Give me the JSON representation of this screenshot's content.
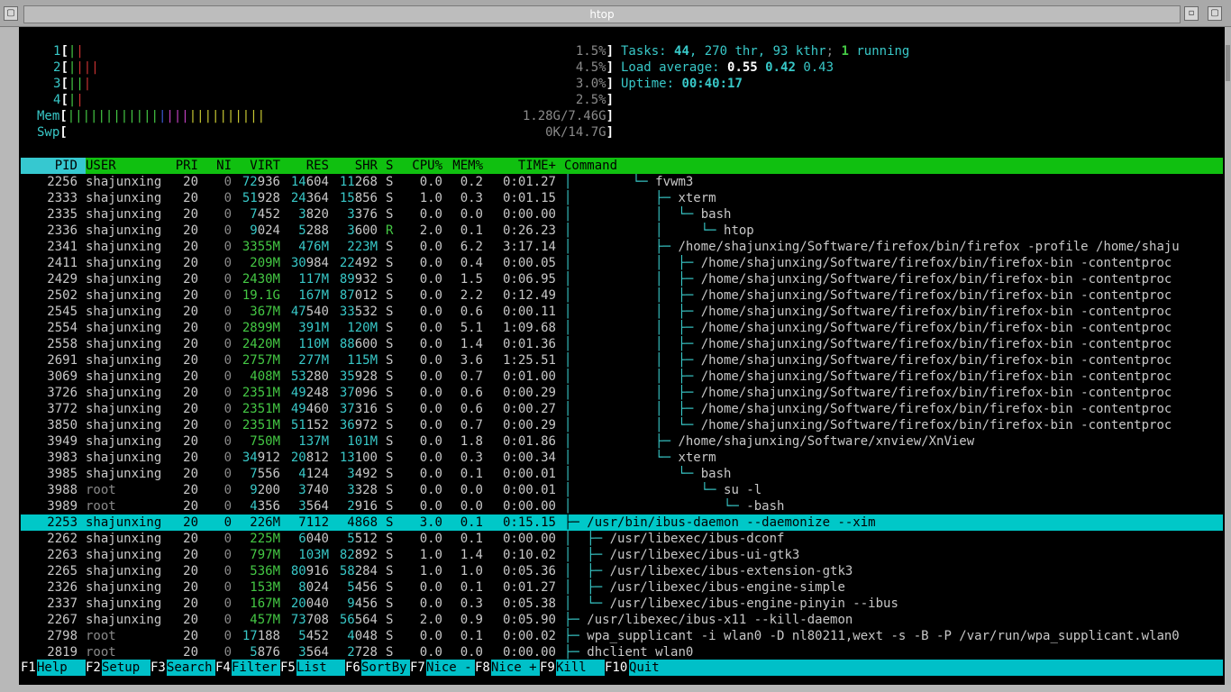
{
  "window": {
    "title": "htop"
  },
  "meters": {
    "cpus": [
      {
        "num": "1",
        "pct": "1.5%"
      },
      {
        "num": "2",
        "pct": "4.5%"
      },
      {
        "num": "3",
        "pct": "3.0%"
      },
      {
        "num": "4",
        "pct": "2.5%"
      }
    ],
    "mem": {
      "label": "Mem",
      "value": "1.28G/7.46G"
    },
    "swp": {
      "label": "Swp",
      "value": "0K/14.7G"
    }
  },
  "summary": {
    "tasks_label": "Tasks:",
    "tasks": "44",
    "thr": "270 thr",
    "kthr": "93 kthr",
    "running": "1",
    "running_label": "running",
    "load_label": "Load average:",
    "load1": "0.55",
    "load5": "0.42",
    "load15": "0.43",
    "uptime_label": "Uptime:",
    "uptime": "00:40:17"
  },
  "columns": [
    "PID",
    "USER",
    "PRI",
    "NI",
    "VIRT",
    "RES",
    "SHR",
    "S",
    "CPU%",
    "MEM%",
    "TIME+",
    "Command"
  ],
  "processes": [
    {
      "pid": "2256",
      "user": "shajunxing",
      "pri": "20",
      "ni": "0",
      "virt": "72936",
      "res": "14604",
      "shr": "11268",
      "s": "S",
      "cpu": "0.0",
      "mem": "0.2",
      "time": "0:01.27",
      "tree": "│        └─ ",
      "cmd": "fvwm3"
    },
    {
      "pid": "2333",
      "user": "shajunxing",
      "pri": "20",
      "ni": "0",
      "virt": "51928",
      "res": "24364",
      "shr": "15856",
      "s": "S",
      "cpu": "1.0",
      "mem": "0.3",
      "time": "0:01.15",
      "tree": "│           ├─ ",
      "cmd": "xterm"
    },
    {
      "pid": "2335",
      "user": "shajunxing",
      "pri": "20",
      "ni": "0",
      "virt": "7452",
      "res": "3820",
      "shr": "3376",
      "s": "S",
      "cpu": "0.0",
      "mem": "0.0",
      "time": "0:00.00",
      "tree": "│           │  └─ ",
      "cmd": "bash"
    },
    {
      "pid": "2336",
      "user": "shajunxing",
      "pri": "20",
      "ni": "0",
      "virt": "9024",
      "res": "5288",
      "shr": "3600",
      "s": "R",
      "cpu": "2.0",
      "mem": "0.1",
      "time": "0:26.23",
      "tree": "│           │     └─ ",
      "cmd": "htop"
    },
    {
      "pid": "2341",
      "user": "shajunxing",
      "pri": "20",
      "ni": "0",
      "virt": "3355M",
      "res": "476M",
      "shr": "223M",
      "s": "S",
      "cpu": "0.0",
      "mem": "6.2",
      "time": "3:17.14",
      "tree": "│           ├─ ",
      "cmd": "/home/shajunxing/Software/firefox/bin/firefox -profile /home/shaju"
    },
    {
      "pid": "2411",
      "user": "shajunxing",
      "pri": "20",
      "ni": "0",
      "virt": "209M",
      "res": "30984",
      "shr": "22492",
      "s": "S",
      "cpu": "0.0",
      "mem": "0.4",
      "time": "0:00.05",
      "tree": "│           │  ├─ ",
      "cmd": "/home/shajunxing/Software/firefox/bin/firefox-bin -contentproc"
    },
    {
      "pid": "2429",
      "user": "shajunxing",
      "pri": "20",
      "ni": "0",
      "virt": "2430M",
      "res": "117M",
      "shr": "89932",
      "s": "S",
      "cpu": "0.0",
      "mem": "1.5",
      "time": "0:06.95",
      "tree": "│           │  ├─ ",
      "cmd": "/home/shajunxing/Software/firefox/bin/firefox-bin -contentproc"
    },
    {
      "pid": "2502",
      "user": "shajunxing",
      "pri": "20",
      "ni": "0",
      "virt": "19.1G",
      "res": "167M",
      "shr": "87012",
      "s": "S",
      "cpu": "0.0",
      "mem": "2.2",
      "time": "0:12.49",
      "tree": "│           │  ├─ ",
      "cmd": "/home/shajunxing/Software/firefox/bin/firefox-bin -contentproc"
    },
    {
      "pid": "2545",
      "user": "shajunxing",
      "pri": "20",
      "ni": "0",
      "virt": "367M",
      "res": "47540",
      "shr": "33532",
      "s": "S",
      "cpu": "0.0",
      "mem": "0.6",
      "time": "0:00.11",
      "tree": "│           │  ├─ ",
      "cmd": "/home/shajunxing/Software/firefox/bin/firefox-bin -contentproc"
    },
    {
      "pid": "2554",
      "user": "shajunxing",
      "pri": "20",
      "ni": "0",
      "virt": "2899M",
      "res": "391M",
      "shr": "120M",
      "s": "S",
      "cpu": "0.0",
      "mem": "5.1",
      "time": "1:09.68",
      "tree": "│           │  ├─ ",
      "cmd": "/home/shajunxing/Software/firefox/bin/firefox-bin -contentproc"
    },
    {
      "pid": "2558",
      "user": "shajunxing",
      "pri": "20",
      "ni": "0",
      "virt": "2420M",
      "res": "110M",
      "shr": "88600",
      "s": "S",
      "cpu": "0.0",
      "mem": "1.4",
      "time": "0:01.36",
      "tree": "│           │  ├─ ",
      "cmd": "/home/shajunxing/Software/firefox/bin/firefox-bin -contentproc"
    },
    {
      "pid": "2691",
      "user": "shajunxing",
      "pri": "20",
      "ni": "0",
      "virt": "2757M",
      "res": "277M",
      "shr": "115M",
      "s": "S",
      "cpu": "0.0",
      "mem": "3.6",
      "time": "1:25.51",
      "tree": "│           │  ├─ ",
      "cmd": "/home/shajunxing/Software/firefox/bin/firefox-bin -contentproc"
    },
    {
      "pid": "3069",
      "user": "shajunxing",
      "pri": "20",
      "ni": "0",
      "virt": "408M",
      "res": "53280",
      "shr": "35928",
      "s": "S",
      "cpu": "0.0",
      "mem": "0.7",
      "time": "0:01.00",
      "tree": "│           │  ├─ ",
      "cmd": "/home/shajunxing/Software/firefox/bin/firefox-bin -contentproc"
    },
    {
      "pid": "3726",
      "user": "shajunxing",
      "pri": "20",
      "ni": "0",
      "virt": "2351M",
      "res": "49248",
      "shr": "37096",
      "s": "S",
      "cpu": "0.0",
      "mem": "0.6",
      "time": "0:00.29",
      "tree": "│           │  ├─ ",
      "cmd": "/home/shajunxing/Software/firefox/bin/firefox-bin -contentproc"
    },
    {
      "pid": "3772",
      "user": "shajunxing",
      "pri": "20",
      "ni": "0",
      "virt": "2351M",
      "res": "49460",
      "shr": "37316",
      "s": "S",
      "cpu": "0.0",
      "mem": "0.6",
      "time": "0:00.27",
      "tree": "│           │  ├─ ",
      "cmd": "/home/shajunxing/Software/firefox/bin/firefox-bin -contentproc"
    },
    {
      "pid": "3850",
      "user": "shajunxing",
      "pri": "20",
      "ni": "0",
      "virt": "2351M",
      "res": "51152",
      "shr": "36972",
      "s": "S",
      "cpu": "0.0",
      "mem": "0.7",
      "time": "0:00.29",
      "tree": "│           │  └─ ",
      "cmd": "/home/shajunxing/Software/firefox/bin/firefox-bin -contentproc"
    },
    {
      "pid": "3949",
      "user": "shajunxing",
      "pri": "20",
      "ni": "0",
      "virt": "750M",
      "res": "137M",
      "shr": "101M",
      "s": "S",
      "cpu": "0.0",
      "mem": "1.8",
      "time": "0:01.86",
      "tree": "│           ├─ ",
      "cmd": "/home/shajunxing/Software/xnview/XnView"
    },
    {
      "pid": "3983",
      "user": "shajunxing",
      "pri": "20",
      "ni": "0",
      "virt": "34912",
      "res": "20812",
      "shr": "13100",
      "s": "S",
      "cpu": "0.0",
      "mem": "0.3",
      "time": "0:00.34",
      "tree": "│           └─ ",
      "cmd": "xterm"
    },
    {
      "pid": "3985",
      "user": "shajunxing",
      "pri": "20",
      "ni": "0",
      "virt": "7556",
      "res": "4124",
      "shr": "3492",
      "s": "S",
      "cpu": "0.0",
      "mem": "0.1",
      "time": "0:00.01",
      "tree": "│              └─ ",
      "cmd": "bash"
    },
    {
      "pid": "3988",
      "user": "root",
      "pri": "20",
      "ni": "0",
      "virt": "9200",
      "res": "3740",
      "shr": "3328",
      "s": "S",
      "cpu": "0.0",
      "mem": "0.0",
      "time": "0:00.01",
      "tree": "│                 └─ ",
      "cmd": "su -l"
    },
    {
      "pid": "3989",
      "user": "root",
      "pri": "20",
      "ni": "0",
      "virt": "4356",
      "res": "3564",
      "shr": "2916",
      "s": "S",
      "cpu": "0.0",
      "mem": "0.0",
      "time": "0:00.00",
      "tree": "│                    └─ ",
      "cmd": "-bash"
    },
    {
      "pid": "2253",
      "user": "shajunxing",
      "pri": "20",
      "ni": "0",
      "virt": "226M",
      "res": "7112",
      "shr": "4868",
      "s": "S",
      "cpu": "3.0",
      "mem": "0.1",
      "time": "0:15.15",
      "tree": "├─ ",
      "cmd": "/usr/bin/ibus-daemon --daemonize --xim",
      "selected": true
    },
    {
      "pid": "2262",
      "user": "shajunxing",
      "pri": "20",
      "ni": "0",
      "virt": "225M",
      "res": "6040",
      "shr": "5512",
      "s": "S",
      "cpu": "0.0",
      "mem": "0.1",
      "time": "0:00.00",
      "tree": "│  ├─ ",
      "cmd": "/usr/libexec/ibus-dconf"
    },
    {
      "pid": "2263",
      "user": "shajunxing",
      "pri": "20",
      "ni": "0",
      "virt": "797M",
      "res": "103M",
      "shr": "82892",
      "s": "S",
      "cpu": "1.0",
      "mem": "1.4",
      "time": "0:10.02",
      "tree": "│  ├─ ",
      "cmd": "/usr/libexec/ibus-ui-gtk3"
    },
    {
      "pid": "2265",
      "user": "shajunxing",
      "pri": "20",
      "ni": "0",
      "virt": "536M",
      "res": "80916",
      "shr": "58284",
      "s": "S",
      "cpu": "1.0",
      "mem": "1.0",
      "time": "0:05.36",
      "tree": "│  ├─ ",
      "cmd": "/usr/libexec/ibus-extension-gtk3"
    },
    {
      "pid": "2326",
      "user": "shajunxing",
      "pri": "20",
      "ni": "0",
      "virt": "153M",
      "res": "8024",
      "shr": "5456",
      "s": "S",
      "cpu": "0.0",
      "mem": "0.1",
      "time": "0:01.27",
      "tree": "│  ├─ ",
      "cmd": "/usr/libexec/ibus-engine-simple"
    },
    {
      "pid": "2337",
      "user": "shajunxing",
      "pri": "20",
      "ni": "0",
      "virt": "167M",
      "res": "20040",
      "shr": "9456",
      "s": "S",
      "cpu": "0.0",
      "mem": "0.3",
      "time": "0:05.38",
      "tree": "│  └─ ",
      "cmd": "/usr/libexec/ibus-engine-pinyin --ibus"
    },
    {
      "pid": "2267",
      "user": "shajunxing",
      "pri": "20",
      "ni": "0",
      "virt": "457M",
      "res": "73708",
      "shr": "56564",
      "s": "S",
      "cpu": "2.0",
      "mem": "0.9",
      "time": "0:05.90",
      "tree": "├─ ",
      "cmd": "/usr/libexec/ibus-x11 --kill-daemon"
    },
    {
      "pid": "2798",
      "user": "root",
      "pri": "20",
      "ni": "0",
      "virt": "17188",
      "res": "5452",
      "shr": "4048",
      "s": "S",
      "cpu": "0.0",
      "mem": "0.1",
      "time": "0:00.02",
      "tree": "├─ ",
      "cmd": "wpa_supplicant -i wlan0 -D nl80211,wext -s -B -P /var/run/wpa_supplicant.wlan0"
    },
    {
      "pid": "2819",
      "user": "root",
      "pri": "20",
      "ni": "0",
      "virt": "5876",
      "res": "3564",
      "shr": "2728",
      "s": "S",
      "cpu": "0.0",
      "mem": "0.0",
      "time": "0:00.00",
      "tree": "├─ ",
      "cmd": "dhclient wlan0"
    }
  ],
  "fkeys": [
    {
      "key": "F1",
      "label": "Help"
    },
    {
      "key": "F2",
      "label": "Setup"
    },
    {
      "key": "F3",
      "label": "Search"
    },
    {
      "key": "F4",
      "label": "Filter"
    },
    {
      "key": "F5",
      "label": "List"
    },
    {
      "key": "F6",
      "label": "SortBy"
    },
    {
      "key": "F7",
      "label": "Nice -"
    },
    {
      "key": "F8",
      "label": "Nice +"
    },
    {
      "key": "F9",
      "label": "Kill"
    },
    {
      "key": "F10",
      "label": "Quit"
    }
  ],
  "colors": {
    "header_bg": "#10c010",
    "selected_bg": "#00c8c8",
    "fkey_bg": "#00c0c8",
    "terminal_bg": "#000000"
  }
}
